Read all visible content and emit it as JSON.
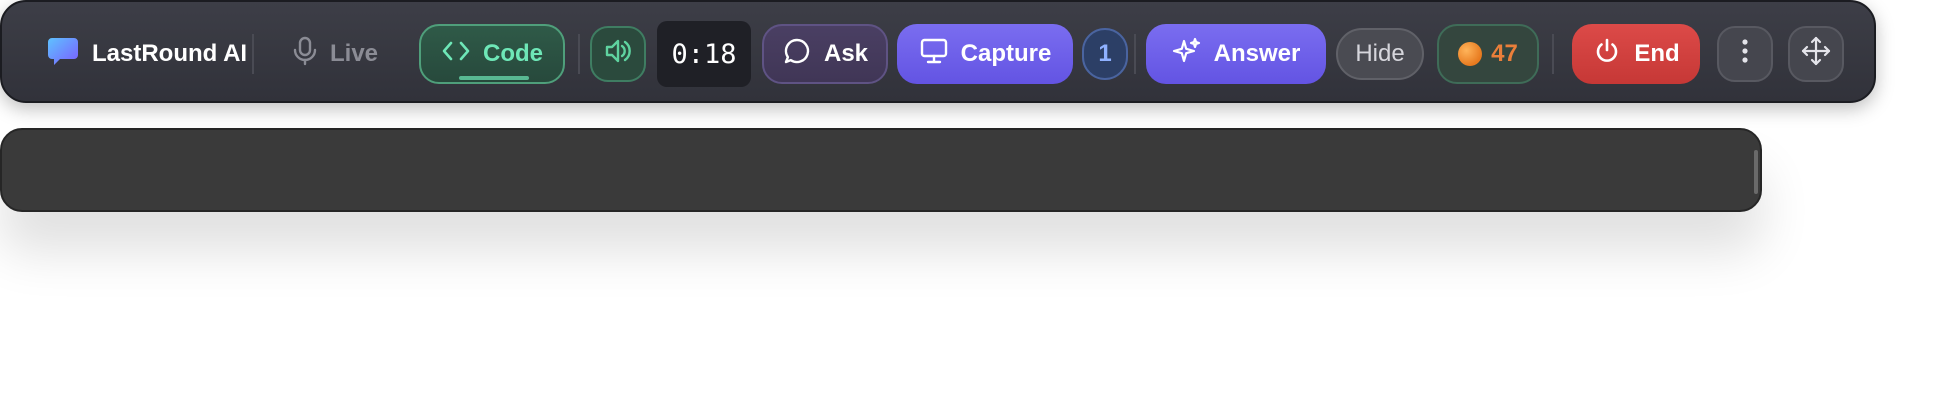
{
  "toolbar": {
    "brand": {
      "label": "LastRound AI",
      "icon": "chat-bubble-icon"
    },
    "live": {
      "label": "Live",
      "icon": "microphone-icon"
    },
    "code": {
      "label": "Code",
      "icon": "code-brackets-icon"
    },
    "audio": {
      "icon": "speaker-icon"
    },
    "timer": {
      "value": "0:18"
    },
    "ask": {
      "label": "Ask",
      "icon": "message-circle-icon"
    },
    "capture": {
      "label": "Capture",
      "icon": "monitor-icon"
    },
    "capture_count": {
      "value": "1"
    },
    "answer": {
      "label": "Answer",
      "icon": "sparkles-icon"
    },
    "hide": {
      "label": "Hide"
    },
    "coins": {
      "value": "47",
      "icon": "coin-icon"
    },
    "end": {
      "label": "End",
      "icon": "power-icon"
    },
    "more": {
      "icon": "more-vertical-icon"
    },
    "move": {
      "icon": "move-icon"
    }
  },
  "colors": {
    "toolbar_bg": "#36373f",
    "code_accent": "#6ee7b7",
    "primary_purple": "#6c5ee9",
    "end_red": "#d4413f",
    "coin_orange": "#ea7f3a",
    "count_blue": "#8fb1ff",
    "panel_bg": "#3a3a3a"
  }
}
